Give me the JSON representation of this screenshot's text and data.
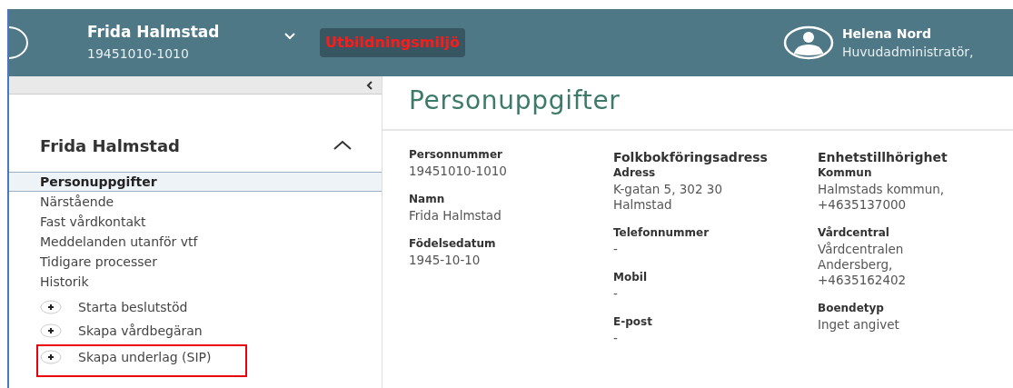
{
  "header": {
    "patient_name": "Frida Halmstad",
    "patient_id": "19451010-1010",
    "environment_badge": "Utbildningsmiljö",
    "user": {
      "name": "Helena Nord",
      "role": "Huvudadministratör,"
    }
  },
  "sidebar": {
    "title": "Frida Halmstad",
    "expanded": true,
    "items": [
      {
        "label": "Personuppgifter",
        "selected": true
      },
      {
        "label": "Närstående",
        "selected": false
      },
      {
        "label": "Fast vårdkontakt",
        "selected": false
      },
      {
        "label": "Meddelanden utanför vtf",
        "selected": false
      },
      {
        "label": "Tidigare processer",
        "selected": false
      },
      {
        "label": "Historik",
        "selected": false
      }
    ],
    "actions": [
      {
        "label": "Starta beslutstöd",
        "highlighted": false
      },
      {
        "label": "Skapa vårdbegäran",
        "highlighted": false
      },
      {
        "label": "Skapa underlag (SIP)",
        "highlighted": true
      }
    ]
  },
  "main": {
    "title": "Personuppgifter",
    "columns": [
      {
        "fields": [
          {
            "label": "Personnummer",
            "value": "19451010-1010"
          },
          {
            "label": "Namn",
            "value": "Frida Halmstad"
          },
          {
            "label": "Födelsedatum",
            "value": "1945-10-10"
          }
        ]
      },
      {
        "heading": "Folkbokföringsadress",
        "fields": [
          {
            "label": "Adress",
            "value": "K-gatan 5, 302 30 Halmstad"
          },
          {
            "label": "Telefonnummer",
            "value": "-"
          },
          {
            "label": "Mobil",
            "value": "-"
          },
          {
            "label": "E-post",
            "value": "-"
          }
        ]
      },
      {
        "heading": "Enhetstillhörighet",
        "fields": [
          {
            "label": "Kommun",
            "value": "Halmstads kommun, +4635137000"
          },
          {
            "label": "Vårdcentral",
            "value": "Vårdcentralen Andersberg, +4635162402"
          },
          {
            "label": "Boendetyp",
            "value": "Inget angivet"
          }
        ]
      }
    ]
  }
}
